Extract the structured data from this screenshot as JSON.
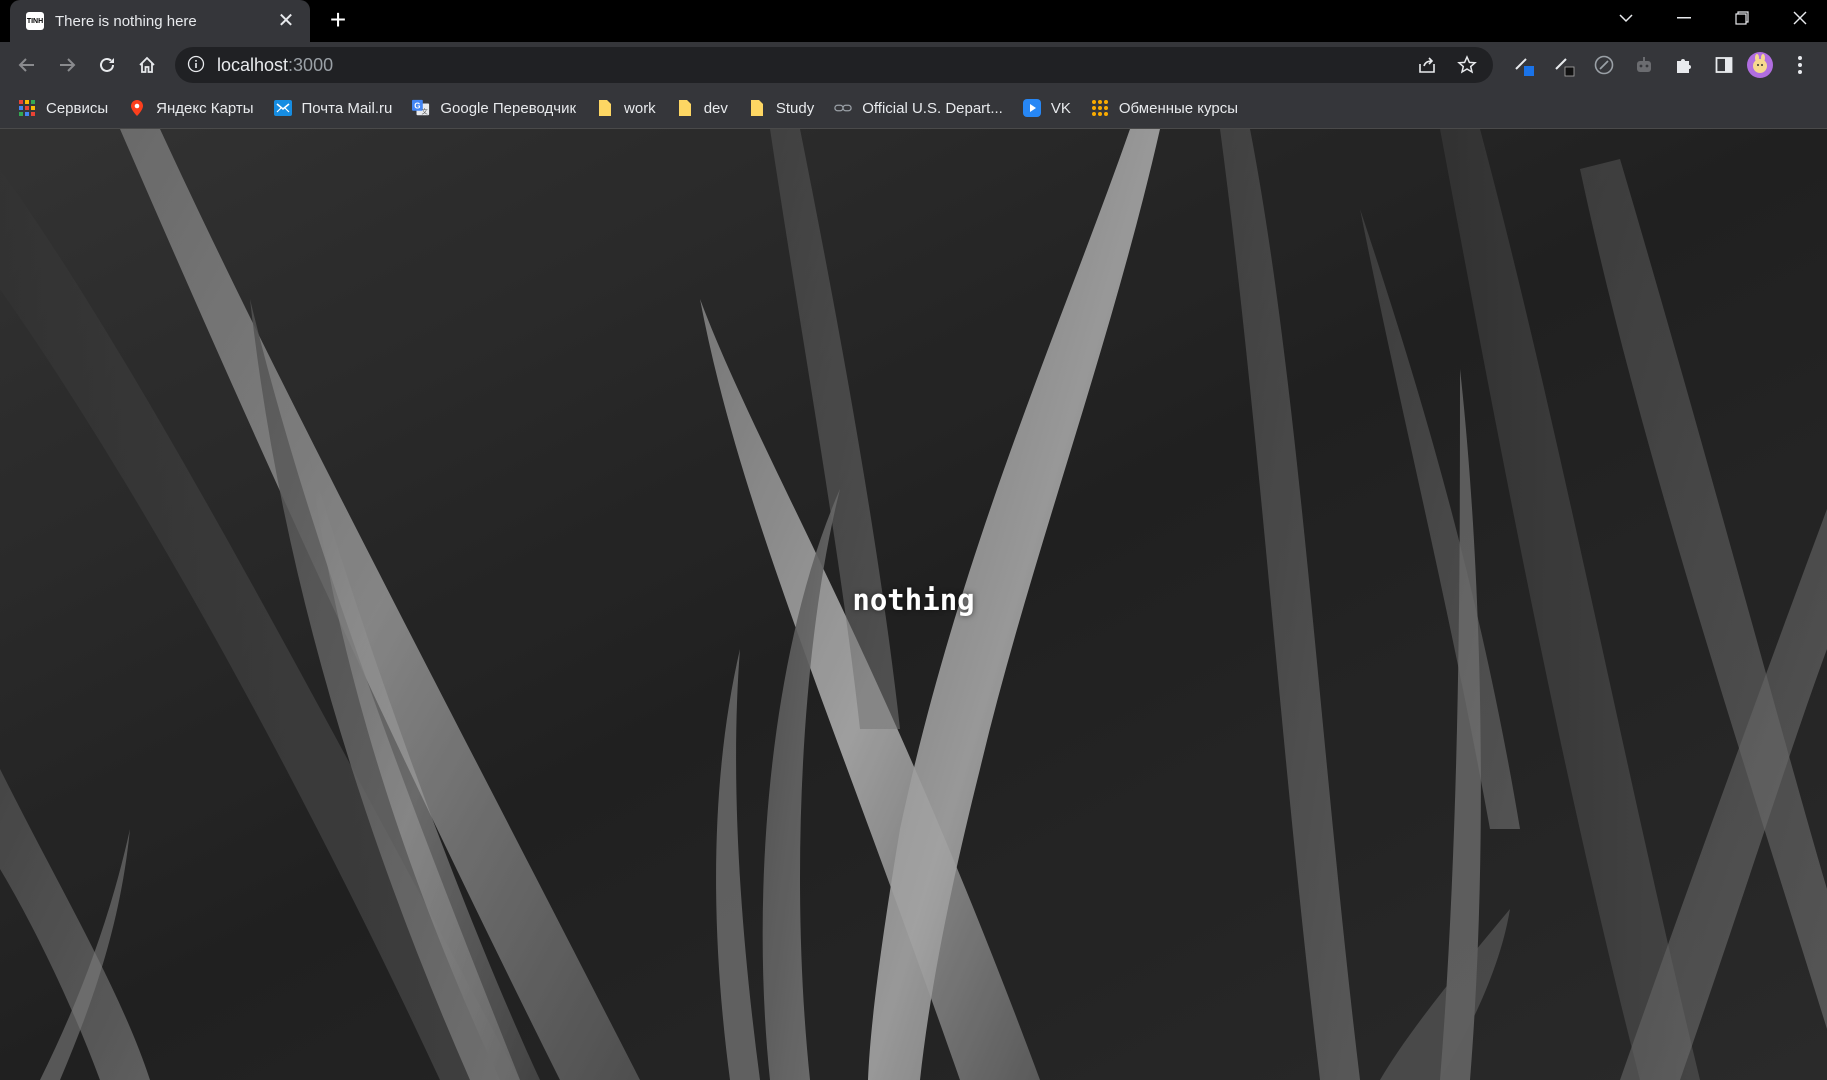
{
  "tab": {
    "favicon_text": "TINH",
    "title": "There is nothing here"
  },
  "address_bar": {
    "host": "localhost",
    "port": ":3000"
  },
  "bookmarks": [
    {
      "label": "Сервисы",
      "icon": "apps-grid-icon"
    },
    {
      "label": "Яндекс Карты",
      "icon": "map-pin-icon"
    },
    {
      "label": "Почта Mail.ru",
      "icon": "mail-icon"
    },
    {
      "label": "Google Переводчик",
      "icon": "translate-icon"
    },
    {
      "label": "work",
      "icon": "folder-icon"
    },
    {
      "label": "dev",
      "icon": "folder-icon"
    },
    {
      "label": "Study",
      "icon": "folder-icon"
    },
    {
      "label": "Official U.S. Depart...",
      "icon": "link-icon"
    },
    {
      "label": "VK",
      "icon": "play-icon"
    },
    {
      "label": "Обменные курсы",
      "icon": "apps-grid-icon"
    }
  ],
  "page": {
    "headline": "nothing"
  },
  "colors": {
    "titlebar": "#000000",
    "toolbar": "#35363a",
    "omnibox": "#202124",
    "text": "#e8eaed"
  }
}
